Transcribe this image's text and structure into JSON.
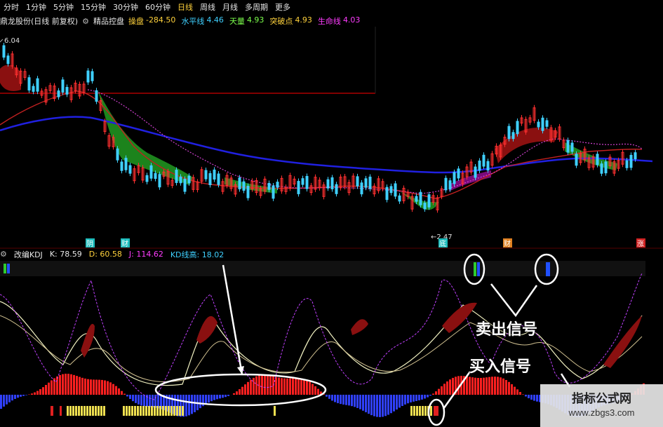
{
  "toolbar": {
    "items": [
      "分时",
      "1分钟",
      "5分钟",
      "15分钟",
      "30分钟",
      "60分钟",
      "日线",
      "周线",
      "月线",
      "多周期",
      "更多"
    ],
    "active_index": 6
  },
  "stock_header": {
    "name": "鼎龙股份(日线 前复权)",
    "indicator_name": "精品控盘",
    "metrics": [
      {
        "label": "操盘",
        "value": "-284.50",
        "color": "#ffd23c"
      },
      {
        "label": "水平线",
        "value": "4.46",
        "color": "#3fd0ff"
      },
      {
        "label": "天量",
        "value": "4.93",
        "color": "#7cff4c"
      },
      {
        "label": "突破点",
        "value": "4.93",
        "color": "#ffd23c"
      },
      {
        "label": "生命线",
        "value": "4.03",
        "color": "#ff3cff"
      }
    ]
  },
  "main_chart": {
    "price_high_label": "6.04",
    "price_low_label": "2.47",
    "markers": [
      {
        "text": "阴",
        "color": "#1cbcbc"
      },
      {
        "text": "财",
        "color": "#1cbcbc"
      },
      {
        "text": "底",
        "color": "#1cbcbc"
      },
      {
        "text": "财",
        "color": "#e08020"
      },
      {
        "text": "涨",
        "color": "#d02020"
      }
    ]
  },
  "kdj_header": {
    "indicator": "改编KDJ",
    "k": "K: 78.59",
    "d": "D: 60.58",
    "j": "J: 114.62",
    "kd": "KD线高: 18.02"
  },
  "annotations": {
    "sell_signal": "卖出信号",
    "buy_signal": "买入信号"
  },
  "watermark": {
    "title": "指标公式网",
    "url": "www.zbgs3.com"
  },
  "colors": {
    "up": "#ff3030",
    "down": "#3fd0ff",
    "ma_red": "#c02020",
    "ma_blue": "#2020e0",
    "ma_magenta": "#d040d0",
    "band_green": "#1e8a1e",
    "band_red": "#8a1010",
    "horizontal_line": "#cc0000"
  }
}
